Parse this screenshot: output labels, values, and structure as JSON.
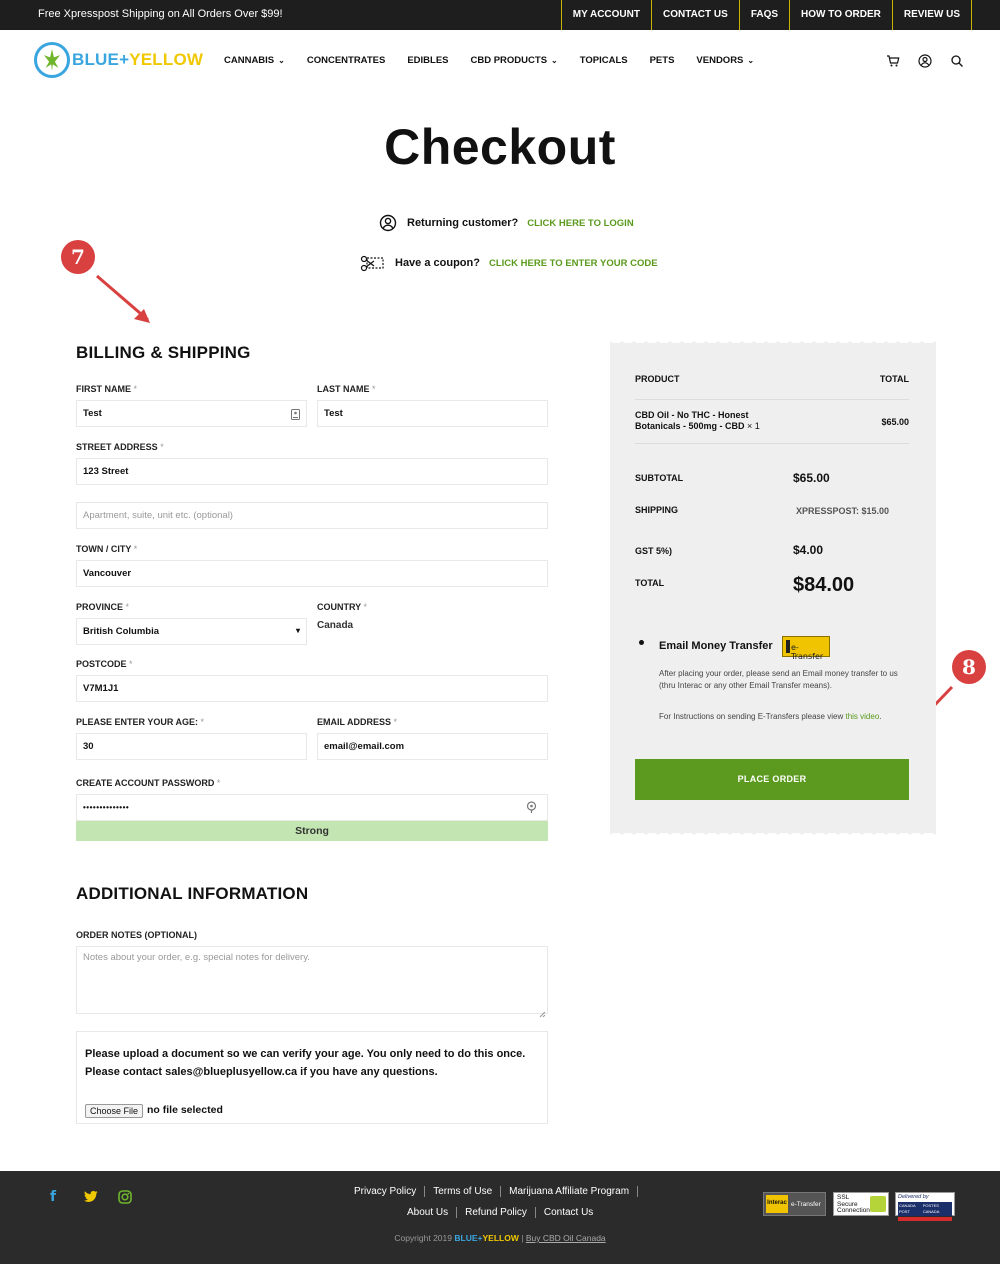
{
  "topbar": {
    "promo": "Free Xpresspost Shipping on All Orders Over $99!",
    "links": [
      "MY ACCOUNT",
      "CONTACT US",
      "FAQS",
      "HOW TO ORDER",
      "REVIEW US"
    ]
  },
  "header": {
    "logo_blue": "BLUE",
    "logo_plus": "+",
    "logo_yellow": "YELLOW",
    "nav": [
      {
        "label": "CANNABIS",
        "dropdown": true
      },
      {
        "label": "CONCENTRATES",
        "dropdown": false
      },
      {
        "label": "EDIBLES",
        "dropdown": false
      },
      {
        "label": "CBD PRODUCTS",
        "dropdown": true
      },
      {
        "label": "TOPICALS",
        "dropdown": false
      },
      {
        "label": "PETS",
        "dropdown": false
      },
      {
        "label": "VENDORS",
        "dropdown": true
      }
    ],
    "chevron": "⌄",
    "icons": [
      "cart-icon",
      "user-icon",
      "search-icon"
    ]
  },
  "page": {
    "title": "Checkout",
    "returning_label": "Returning customer?",
    "returning_link": "CLICK HERE TO LOGIN",
    "coupon_label": "Have a coupon?",
    "coupon_link": "CLICK HERE TO ENTER YOUR CODE"
  },
  "annotations": {
    "step_a": "7",
    "step_b": "8",
    "color": "#d94040"
  },
  "billing": {
    "title": "BILLING & SHIPPING",
    "req_mark": "*",
    "first_name_label": "FIRST NAME",
    "first_name_value": "Test",
    "last_name_label": "LAST NAME",
    "last_name_value": "Test",
    "street_label": "STREET ADDRESS",
    "street_value": "123 Street",
    "apt_placeholder": "Apartment, suite, unit etc. (optional)",
    "city_label": "TOWN / CITY",
    "city_value": "Vancouver",
    "province_label": "PROVINCE",
    "province_value": "British Columbia",
    "country_label": "COUNTRY",
    "country_value": "Canada",
    "postcode_label": "POSTCODE",
    "postcode_value": "V7M1J1",
    "age_label": "PLEASE ENTER YOUR AGE:",
    "age_value": "30",
    "email_label": "EMAIL ADDRESS",
    "email_value": "email@email.com",
    "password_label": "CREATE ACCOUNT PASSWORD",
    "password_value": "••••••••••••••",
    "strength": "Strong",
    "strength_color": "#c2e5b2"
  },
  "additional": {
    "title": "ADDITIONAL INFORMATION",
    "notes_label": "ORDER NOTES (OPTIONAL)",
    "notes_placeholder": "Notes about your order, e.g. special notes for delivery.",
    "upload_msg_1": "Please upload a document so we can verify your age. You only need to do this once.",
    "upload_msg_2": "Please contact sales@blueplusyellow.ca if you have any questions.",
    "file_button": "Choose File",
    "file_status": "no file selected"
  },
  "summary": {
    "col_product": "PRODUCT",
    "col_total": "TOTAL",
    "item_line1": "CBD Oil - No THC - Honest",
    "item_line2": "Botanicals - 500mg - CBD",
    "item_qty": "× 1",
    "item_total": "$65.00",
    "subtotal_label": "SUBTOTAL",
    "subtotal_value": "$65.00",
    "shipping_label": "SHIPPING",
    "shipping_value": "XPRESSPOST: $15.00",
    "gst_label": "GST 5%)",
    "gst_value": "$4.00",
    "total_label": "TOTAL",
    "total_value": "$84.00",
    "payment_method": "Email Money Transfer",
    "etransfer_badge": "e-Transfer",
    "payment_desc": "After placing your order, please send an Email money transfer to us (thru Interac or any other Email Transfer means).",
    "instructions_text": "For Instructions on sending E-Transfers please view",
    "instructions_link": "this video",
    "instructions_end": ".",
    "place_order": "PLACE ORDER",
    "accent": "#5b9a1e"
  },
  "footer": {
    "social": [
      "facebook-icon",
      "twitter-icon",
      "instagram-icon"
    ],
    "links_row1": [
      "Privacy Policy",
      "Terms of Use",
      "Marijuana Affiliate Program"
    ],
    "links_row2": [
      "About Us",
      "Refund Policy",
      "Contact Us"
    ],
    "copyright": "Copyright 2019",
    "brand_blue": "BLUE",
    "brand_plus": "+",
    "brand_yellow": "YELLOW",
    "sep": "|",
    "copy_link": "Buy CBD Oil Canada",
    "badge_interac": "Interac",
    "badge_etransfer": "e-Transfer",
    "badge_ssl": "SSL",
    "badge_ssl_sub1": "Secure",
    "badge_ssl_sub2": "Connection",
    "badge_delivered": "Delivered by",
    "badge_canada_post": "CANADA POST",
    "badge_postes_canada": "POSTES CANADA"
  }
}
